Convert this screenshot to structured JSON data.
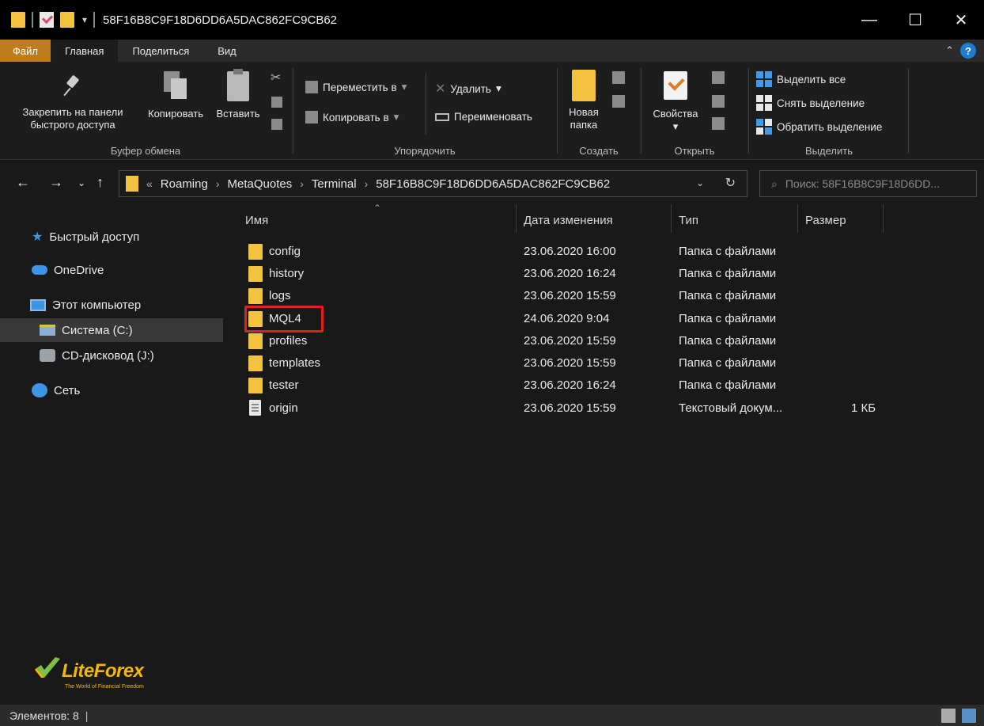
{
  "window": {
    "title": "58F16B8C9F18D6DD6A5DAC862FC9CB62",
    "minimize": "—",
    "maximize": "☐",
    "close": "✕"
  },
  "ribbon_tabs": [
    {
      "label": "Файл"
    },
    {
      "label": "Главная"
    },
    {
      "label": "Поделиться"
    },
    {
      "label": "Вид"
    }
  ],
  "ribbon": {
    "clipboard": {
      "pin_line1": "Закрепить на панели",
      "pin_line2": "быстрого доступа",
      "copy": "Копировать",
      "paste": "Вставить",
      "group": "Буфер обмена"
    },
    "organize": {
      "move_to": "Переместить в",
      "copy_to": "Копировать в",
      "delete": "Удалить",
      "rename": "Переименовать",
      "group": "Упорядочить"
    },
    "create": {
      "new_folder_line1": "Новая",
      "new_folder_line2": "папка",
      "group": "Создать"
    },
    "open": {
      "properties": "Свойства",
      "group": "Открыть"
    },
    "select": {
      "select_all": "Выделить все",
      "select_none": "Снять выделение",
      "invert": "Обратить выделение",
      "group": "Выделить"
    }
  },
  "address": {
    "prefix": "«",
    "crumbs": [
      "Roaming",
      "MetaQuotes",
      "Terminal",
      "58F16B8C9F18D6DD6A5DAC862FC9CB62"
    ],
    "separator": "›"
  },
  "search": {
    "placeholder": "Поиск: 58F16B8C9F18D6DD..."
  },
  "sidebar": {
    "items": [
      {
        "label": "Быстрый доступ",
        "icon": "star-icon"
      },
      {
        "label": "OneDrive",
        "icon": "cloud-icon"
      },
      {
        "label": "Этот компьютер",
        "icon": "computer-icon"
      },
      {
        "label": "Система (C:)",
        "icon": "drive-icon"
      },
      {
        "label": "CD-дисковод (J:)",
        "icon": "cd-drive-icon"
      },
      {
        "label": "Сеть",
        "icon": "network-icon"
      }
    ]
  },
  "columns": {
    "name": "Имя",
    "date": "Дата изменения",
    "type": "Тип",
    "size": "Размер"
  },
  "files": [
    {
      "name": "config",
      "date": "23.06.2020 16:00",
      "type": "Папка с файлами",
      "size": "",
      "kind": "folder"
    },
    {
      "name": "history",
      "date": "23.06.2020 16:24",
      "type": "Папка с файлами",
      "size": "",
      "kind": "folder"
    },
    {
      "name": "logs",
      "date": "23.06.2020 15:59",
      "type": "Папка с файлами",
      "size": "",
      "kind": "folder"
    },
    {
      "name": "MQL4",
      "date": "24.06.2020 9:04",
      "type": "Папка с файлами",
      "size": "",
      "kind": "folder"
    },
    {
      "name": "profiles",
      "date": "23.06.2020 15:59",
      "type": "Папка с файлами",
      "size": "",
      "kind": "folder"
    },
    {
      "name": "templates",
      "date": "23.06.2020 15:59",
      "type": "Папка с файлами",
      "size": "",
      "kind": "folder"
    },
    {
      "name": "tester",
      "date": "23.06.2020 16:24",
      "type": "Папка с файлами",
      "size": "",
      "kind": "folder"
    },
    {
      "name": "origin",
      "date": "23.06.2020 15:59",
      "type": "Текстовый докум...",
      "size": "1 КБ",
      "kind": "text-file"
    }
  ],
  "status": {
    "items_count": "Элементов: 8"
  },
  "logo": {
    "name": "LiteForex",
    "tagline": "The World of Financial Freedom"
  },
  "colors": {
    "file_tab": "#c17d1d",
    "folder": "#f3c33f",
    "highlight_box": "#e0221e",
    "accent_blue": "#3b97e6"
  }
}
